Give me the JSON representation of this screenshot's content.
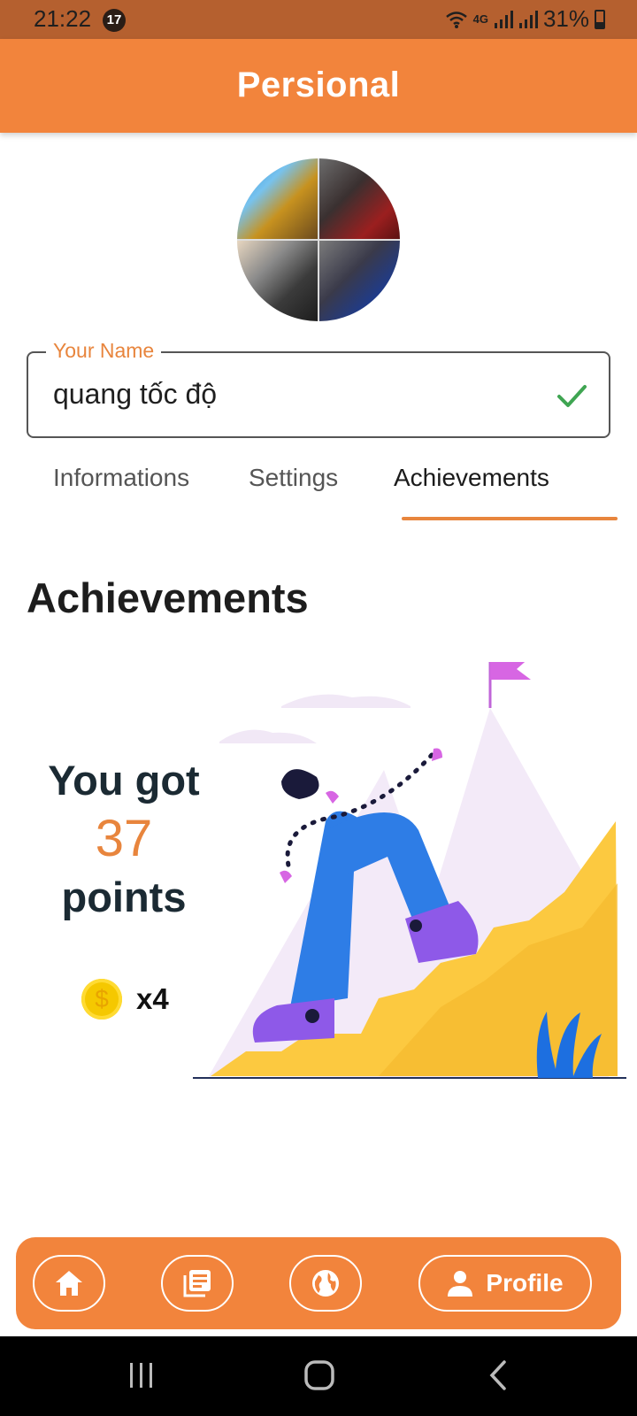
{
  "status_bar": {
    "time": "21:22",
    "notification_count": "17",
    "network": "4G",
    "battery": "31%"
  },
  "app_bar": {
    "title": "Persional"
  },
  "profile": {
    "name_label": "Your Name",
    "name_value": "quang tốc độ"
  },
  "tabs": [
    {
      "label": "Informations",
      "active": false
    },
    {
      "label": "Settings",
      "active": false
    },
    {
      "label": "Achievements",
      "active": true
    }
  ],
  "achievements": {
    "title": "Achievements",
    "points_prefix": "You got",
    "points_value": "37",
    "points_suffix": "points",
    "coin_symbol": "$",
    "coin_count": "x4"
  },
  "bottom_nav": {
    "items": [
      {
        "icon": "home-icon"
      },
      {
        "icon": "news-icon"
      },
      {
        "icon": "globe-icon"
      },
      {
        "icon": "person-icon",
        "label": "Profile",
        "active": true
      }
    ]
  },
  "colors": {
    "accent": "#f2843c",
    "status_bar": "#b5602f",
    "check": "#3fa552"
  }
}
